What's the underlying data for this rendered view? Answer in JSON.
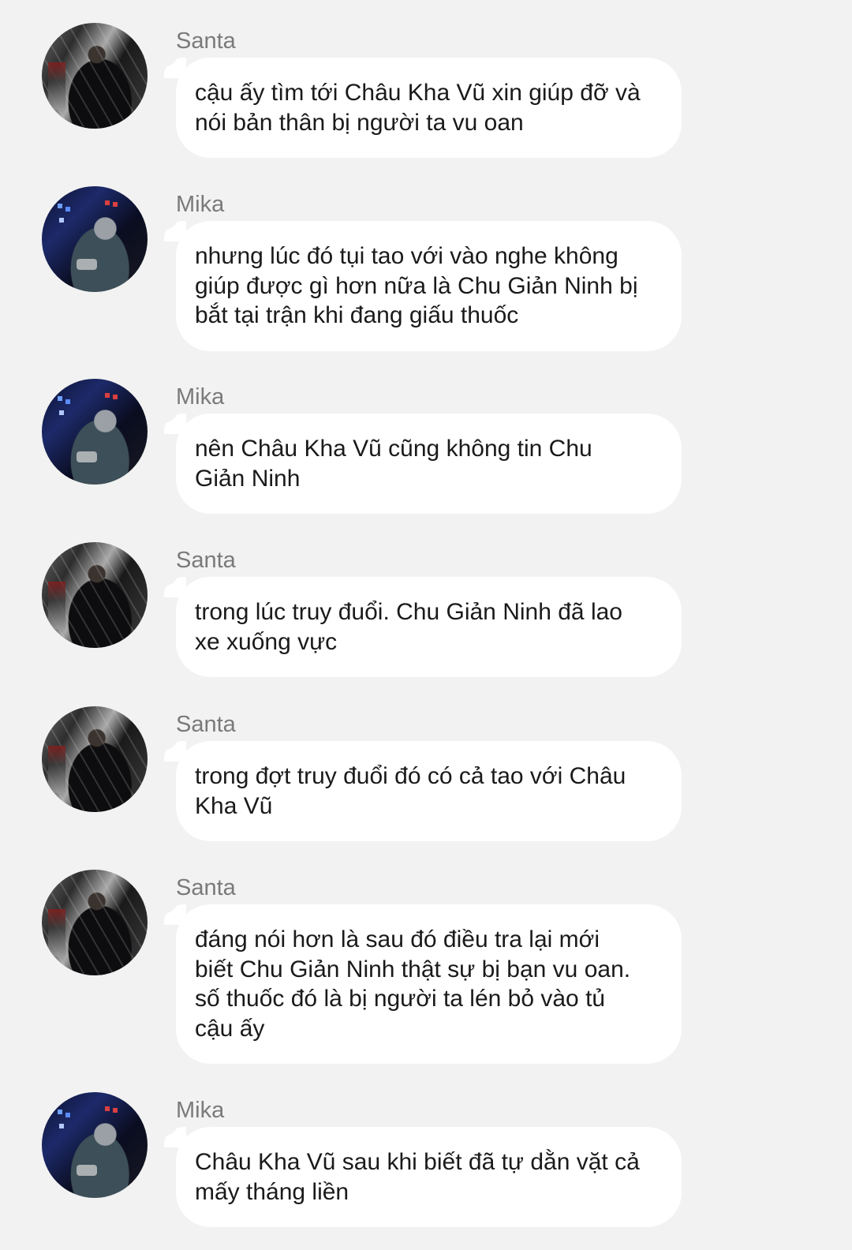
{
  "messages": [
    {
      "sender": "Santa",
      "avatar": "santa-avatar",
      "text": "cậu ấy tìm tới Châu Kha Vũ xin giúp đỡ và\nnói bản thân bị người ta vu oan"
    },
    {
      "sender": "Mika",
      "avatar": "mika-avatar",
      "text": "nhưng lúc đó tụi tao với vào nghe không\ngiúp được gì hơn nữa là Chu Giản Ninh bị\nbắt tại trận khi đang giấu thuốc"
    },
    {
      "sender": "Mika",
      "avatar": "mika-avatar",
      "text": "nên Châu Kha Vũ cũng không tin Chu\nGiản Ninh"
    },
    {
      "sender": "Santa",
      "avatar": "santa-avatar",
      "text": "trong lúc truy đuổi. Chu Giản Ninh đã lao\nxe xuống vực"
    },
    {
      "sender": "Santa",
      "avatar": "santa-avatar",
      "text": "trong đợt truy đuổi đó có cả tao với Châu\nKha Vũ"
    },
    {
      "sender": "Santa",
      "avatar": "santa-avatar",
      "text": "đáng nói hơn là sau đó điều tra lại mới\nbiết Chu Giản Ninh thật sự bị bạn vu oan.\nsố thuốc đó là bị người ta lén bỏ vào tủ\ncậu ấy"
    },
    {
      "sender": "Mika",
      "avatar": "mika-avatar",
      "text": "Châu Kha Vũ sau khi biết đã tự dằn vặt cả\nmấy tháng liền"
    }
  ],
  "colors": {
    "background": "#f2f2f2",
    "bubble": "#ffffff",
    "sender_text": "#7a7a7a",
    "message_text": "#1a1a1a"
  }
}
